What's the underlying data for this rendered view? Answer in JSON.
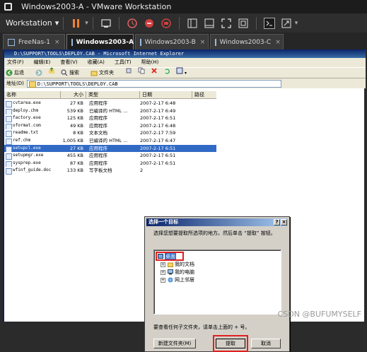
{
  "window": {
    "title": "Windows2003-A - VMware Workstation"
  },
  "toolbar": {
    "workstation_label": "Workstation",
    "workstation_arrow": "▾"
  },
  "tabs": [
    {
      "label": "FreeNas-1",
      "active": false
    },
    {
      "label": "Windows2003-A",
      "active": true
    },
    {
      "label": "Windows2003-B",
      "active": false
    },
    {
      "label": "Windows2003-C",
      "active": false
    }
  ],
  "ie": {
    "title": "D:\\SUPPORT\\TOOLS\\DEPLOY.CAB - Microsoft Internet Explorer",
    "menu": [
      "文件(F)",
      "编辑(E)",
      "查看(V)",
      "收藏(A)",
      "工具(T)",
      "帮助(H)"
    ],
    "toolbar": {
      "back": "后退",
      "search": "搜索",
      "folders": "文件夹"
    },
    "address_label": "地址(D)",
    "address_value": "D:\\SUPPORT\\TOOLS\\DEPLOY.CAB"
  },
  "file_list": {
    "columns": [
      "名称",
      "大小",
      "类型",
      "日期",
      "路径"
    ],
    "rows": [
      {
        "name": "cvtarea.exe",
        "size": "27 KB",
        "type": "应用程序",
        "date": "2007-2-17 6:48"
      },
      {
        "name": "deploy.chm",
        "size": "539 KB",
        "type": "已编译的 HTML ...",
        "date": "2007-2-17 6:49"
      },
      {
        "name": "factory.exe",
        "size": "125 KB",
        "type": "应用程序",
        "date": "2007-2-17 6:51"
      },
      {
        "name": "oformat.com",
        "size": "49 KB",
        "type": "应用程序",
        "date": "2007-2-17 6:48"
      },
      {
        "name": "readme.txt",
        "size": "8 KB",
        "type": "文本文档",
        "date": "2007-2-17 7:59"
      },
      {
        "name": "ref.chm",
        "size": "1,005 KB",
        "type": "已编译的 HTML ...",
        "date": "2007-2-17 6:47"
      },
      {
        "name": "setupcl.exe",
        "size": "27 KB",
        "type": "应用程序",
        "date": "2007-2-17 6:51",
        "selected": true
      },
      {
        "name": "setupmgr.exe",
        "size": "455 KB",
        "type": "应用程序",
        "date": "2007-2-17 6:51"
      },
      {
        "name": "sysprep.exe",
        "size": "87 KB",
        "type": "应用程序",
        "date": "2007-2-17 6:51"
      },
      {
        "name": "wfinf_guide.doc",
        "size": "133 KB",
        "type": "写字板文档",
        "date": "2"
      }
    ]
  },
  "dialog": {
    "title": "选择一个目标",
    "help_btn": "?",
    "close_btn": "×",
    "instruction": "选择您想要提取所选项的地方。然后单击 “提取” 按钮。",
    "tree": [
      {
        "label": "桌面",
        "level": 0,
        "selected": true
      },
      {
        "label": "我的文档",
        "level": 1
      },
      {
        "label": "我的电脑",
        "level": 1
      },
      {
        "label": "网上邻居",
        "level": 1
      }
    ],
    "hint": "要查看任何子文件夹，请单击上面的 + 号。",
    "buttons": {
      "new_folder": "新建文件夹(M)",
      "extract": "提取",
      "cancel": "取消"
    }
  },
  "watermark": "CSDN @BUFUMYSELF"
}
